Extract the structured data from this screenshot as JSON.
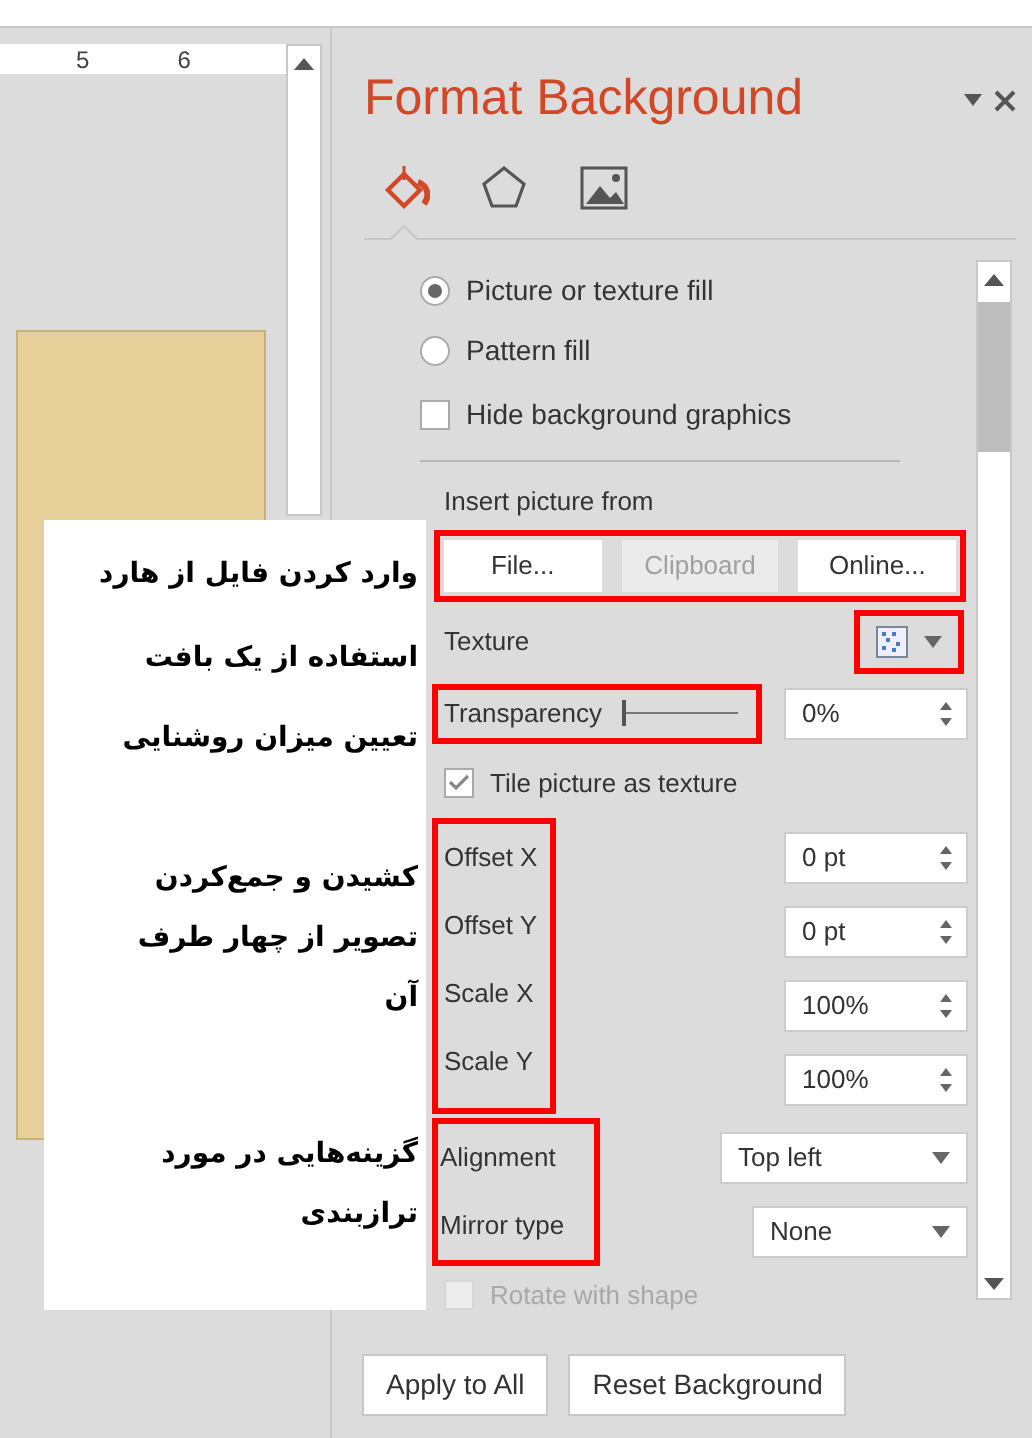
{
  "ruler": {
    "marks": [
      "5",
      "6"
    ]
  },
  "pane": {
    "title": "Format Background",
    "tabs": [
      {
        "kind": "fill",
        "selected": true
      },
      {
        "kind": "effects",
        "selected": false
      },
      {
        "kind": "picture",
        "selected": false
      }
    ],
    "fill_options": [
      {
        "kind": "radio",
        "label": "Picture or texture fill",
        "selected": true
      },
      {
        "kind": "radio",
        "label": "Pattern fill",
        "selected": false
      },
      {
        "kind": "checkbox",
        "label": "Hide background graphics",
        "checked": false
      }
    ],
    "insert_label": "Insert picture from",
    "insert_buttons": [
      {
        "label": "File...",
        "disabled": false
      },
      {
        "label": "Clipboard",
        "disabled": true
      },
      {
        "label": "Online...",
        "disabled": false
      }
    ],
    "insert_annotated": true,
    "texture": {
      "label": "Texture",
      "annotated": true
    },
    "transparency": {
      "label": "Transparency",
      "level": 0,
      "value": "0%",
      "annotated": true
    },
    "tile": {
      "label": "Tile picture as texture",
      "checked": true
    },
    "spin_fields": [
      {
        "label": "Offset X",
        "value": "0 pt"
      },
      {
        "label": "Offset Y",
        "value": "0 pt"
      },
      {
        "label": "Scale X",
        "value": "100%"
      },
      {
        "label": "Scale Y",
        "value": "100%"
      }
    ],
    "spin_annotated": true,
    "dropdowns": [
      {
        "label": "Alignment",
        "value": "Top left"
      },
      {
        "label": "Mirror type",
        "value": "None"
      }
    ],
    "dropdowns_annotated": true,
    "rotate": {
      "label": "Rotate with shape",
      "checked": false,
      "disabled": true
    },
    "buttons": [
      "Apply to All",
      "Reset Background"
    ]
  },
  "annotations": [
    "وارد کردن فایل از هارد",
    "استفاده از یک بافت",
    "تعیین میزان روشنایی",
    "کشیدن و جمع‌کردن تصویر از چهار طرف آن",
    "گزینه‌هایی در مورد ترازبندی"
  ]
}
